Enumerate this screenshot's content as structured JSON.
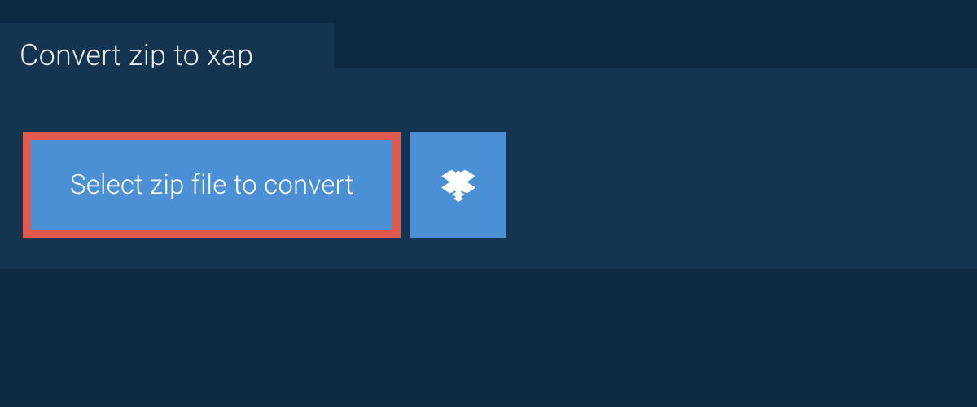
{
  "tab": {
    "label": "Convert zip to xap"
  },
  "actions": {
    "select_file_label": "Select zip file to convert"
  },
  "colors": {
    "background": "#0e2a42",
    "panel": "#153450",
    "button": "#4b90d5",
    "highlight_border": "#e05a50",
    "text_light": "#e9edf1",
    "text_white": "#ffffff"
  }
}
